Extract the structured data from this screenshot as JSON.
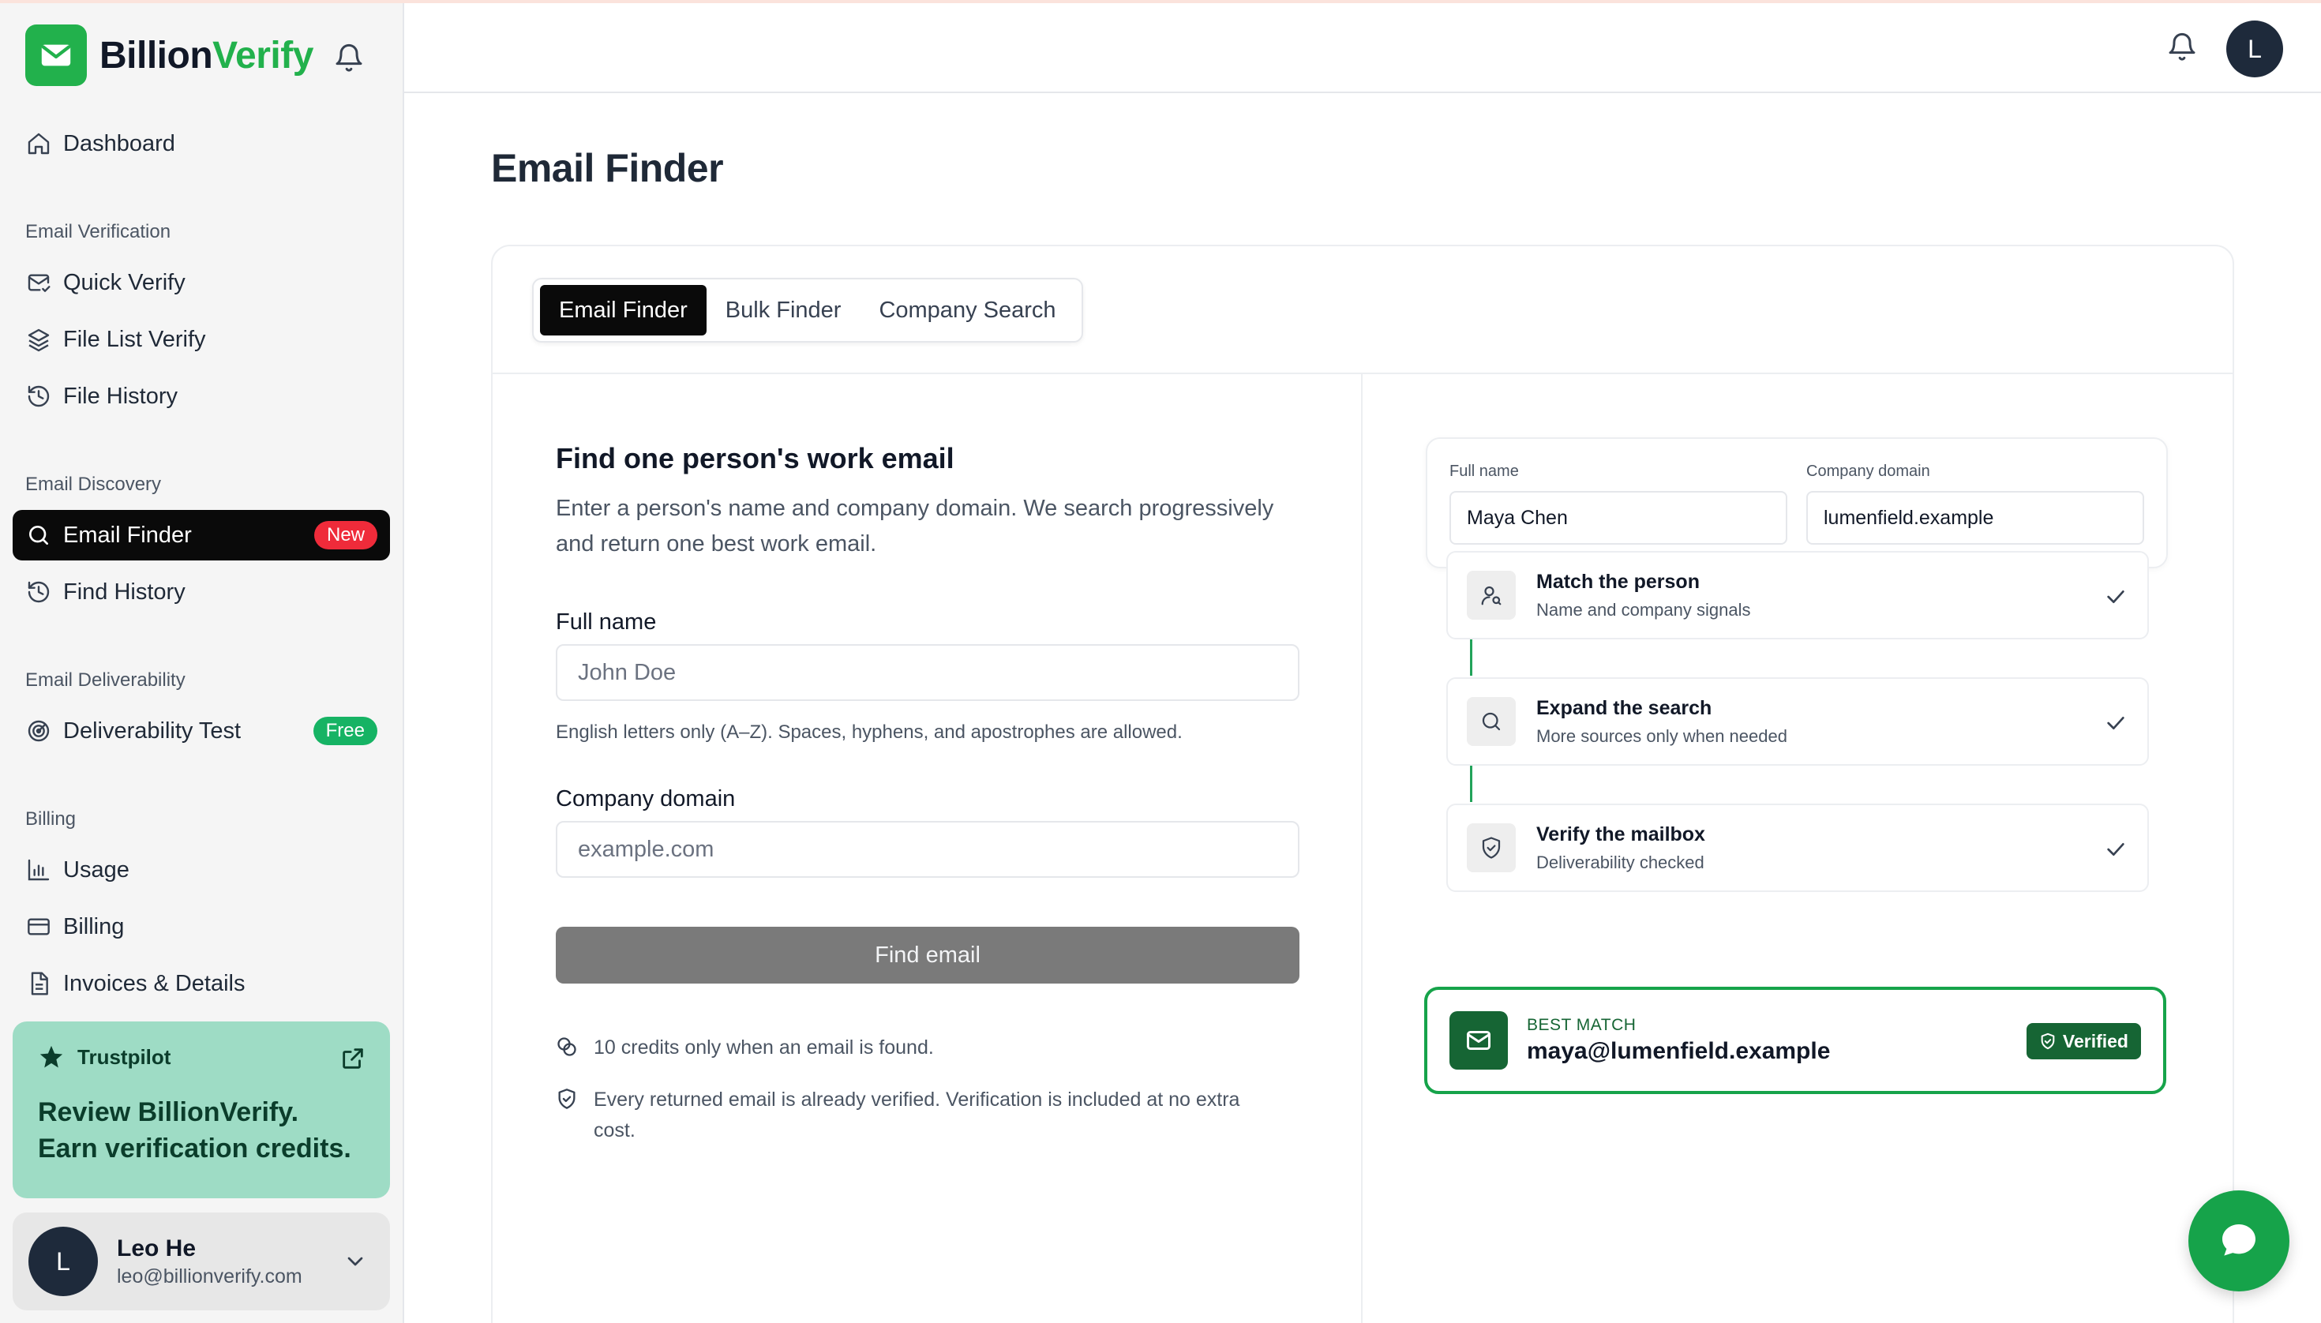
{
  "brand": {
    "name_part1": "Billion",
    "name_part2": "Verify"
  },
  "sidebar": {
    "dashboard": "Dashboard",
    "sections": {
      "verification": "Email Verification",
      "discovery": "Email Discovery",
      "deliverability": "Email Deliverability",
      "billing": "Billing"
    },
    "items": {
      "quick_verify": "Quick Verify",
      "file_list_verify": "File List Verify",
      "file_history": "File History",
      "email_finder": "Email Finder",
      "email_finder_badge": "New",
      "find_history": "Find History",
      "deliverability_test": "Deliverability Test",
      "deliverability_badge": "Free",
      "usage": "Usage",
      "billing": "Billing",
      "invoices": "Invoices & Details"
    },
    "trustpilot": {
      "label": "Trustpilot",
      "text": "Review BillionVerify. Earn verification credits."
    },
    "user": {
      "initial": "L",
      "name": "Leo He",
      "email": "leo@billionverify.com"
    }
  },
  "header": {
    "avatar_initial": "L"
  },
  "page": {
    "title": "Email Finder",
    "tabs": [
      "Email Finder",
      "Bulk Finder",
      "Company Search"
    ],
    "form": {
      "heading": "Find one person's work email",
      "description": "Enter a person's name and company domain. We search progressively and return one best work email.",
      "full_name_label": "Full name",
      "full_name_placeholder": "John Doe",
      "full_name_hint": "English letters only (A–Z). Spaces, hyphens, and apostrophes are allowed.",
      "domain_label": "Company domain",
      "domain_placeholder": "example.com",
      "submit_label": "Find email",
      "note_credits": "10 credits only when an email is found.",
      "note_verified": "Every returned email is already verified. Verification is included at no extra cost."
    },
    "preview": {
      "full_name_label": "Full name",
      "full_name_value": "Maya Chen",
      "domain_label": "Company domain",
      "domain_value": "lumenfield.example",
      "steps": [
        {
          "title": "Match the person",
          "subtitle": "Name and company signals"
        },
        {
          "title": "Expand the search",
          "subtitle": "More sources only when needed"
        },
        {
          "title": "Verify the mailbox",
          "subtitle": "Deliverability checked"
        }
      ],
      "best_match_label": "BEST MATCH",
      "best_match_email": "maya@lumenfield.example",
      "verified_label": "Verified"
    }
  },
  "colors": {
    "brand_green": "#22b14c",
    "dark_green": "#166534",
    "badge_red": "#ef2b3a",
    "badge_green": "#16b364",
    "trust_bg": "#9edcc5"
  },
  "icons": {
    "logo": "mail-icon",
    "notifications": "bell-icon",
    "chat": "chat-bubble-icon"
  }
}
